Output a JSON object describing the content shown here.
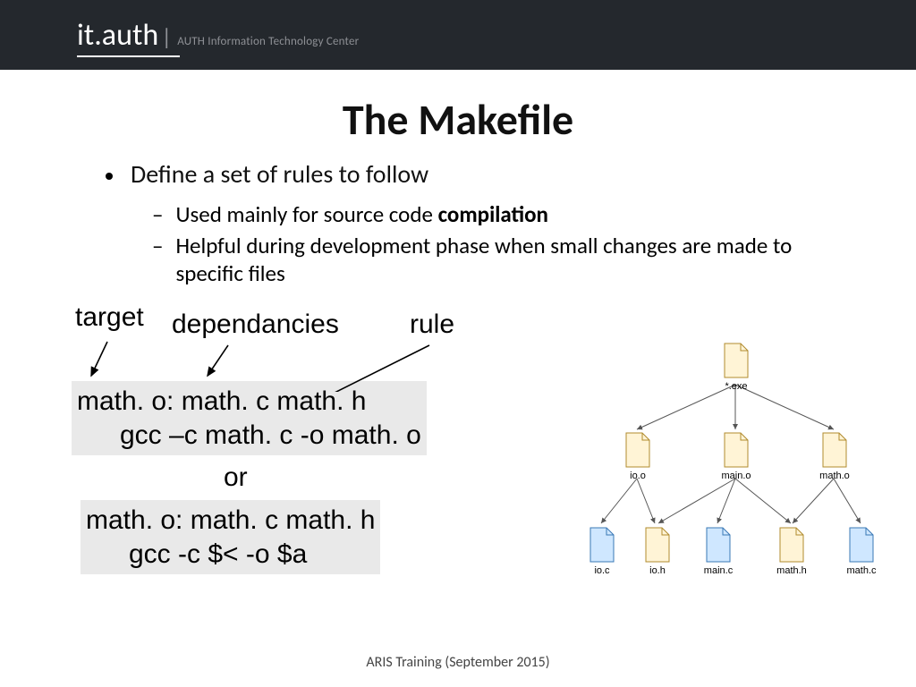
{
  "header": {
    "logo_it": "it",
    "logo_dot": ".",
    "logo_auth": "auth",
    "logo_bar": "|",
    "subtitle": "AUTH Information Technology Center"
  },
  "title": "The Makefile",
  "bullet": "Define a set of rules to follow",
  "sub1_pre": "Used mainly for source code ",
  "sub1_bold": "compilation",
  "sub2": "Helpful during development phase when small changes are made to specific files",
  "labels": {
    "target": "target",
    "dependancies": "dependancies",
    "rule": "rule"
  },
  "code1_l1": "math. o: math. c math. h",
  "code1_l2": "gcc –c math. c -o math. o",
  "or": "or",
  "code2_l1": "math. o: math. c math. h",
  "code2_l2": "gcc -c $< -o $a",
  "tree": {
    "exe": "*.exe",
    "ioo": "io.o",
    "maino": "main.o",
    "matho": "math.o",
    "ioc": "io.c",
    "ioh": "io.h",
    "mainc": "main.c",
    "mathh": "math.h",
    "mathc": "math.c"
  },
  "footer": "ARIS Training (September 2015)"
}
